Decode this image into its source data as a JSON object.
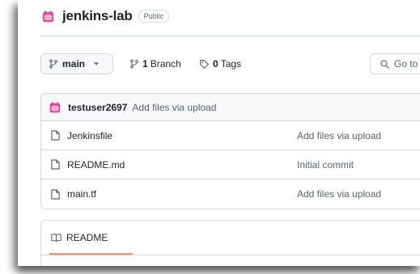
{
  "repo": {
    "name": "jenkins-lab",
    "visibility": "Public",
    "avatar_color": "#e8459b"
  },
  "toolbar": {
    "branch_label": "main",
    "branches_count": "1",
    "branches_label": "Branch",
    "tags_count": "0",
    "tags_label": "Tags",
    "goto_placeholder": "Go to file"
  },
  "latest_commit": {
    "user": "testuser2697",
    "message": "Add files via upload"
  },
  "files": [
    {
      "name": "Jenkinsfile",
      "message": "Add files via upload"
    },
    {
      "name": "README.md",
      "message": "Initial commit"
    },
    {
      "name": "main.tf",
      "message": "Add files via upload"
    }
  ],
  "readme": {
    "tab_label": "README",
    "accent": "#fd8c73"
  }
}
